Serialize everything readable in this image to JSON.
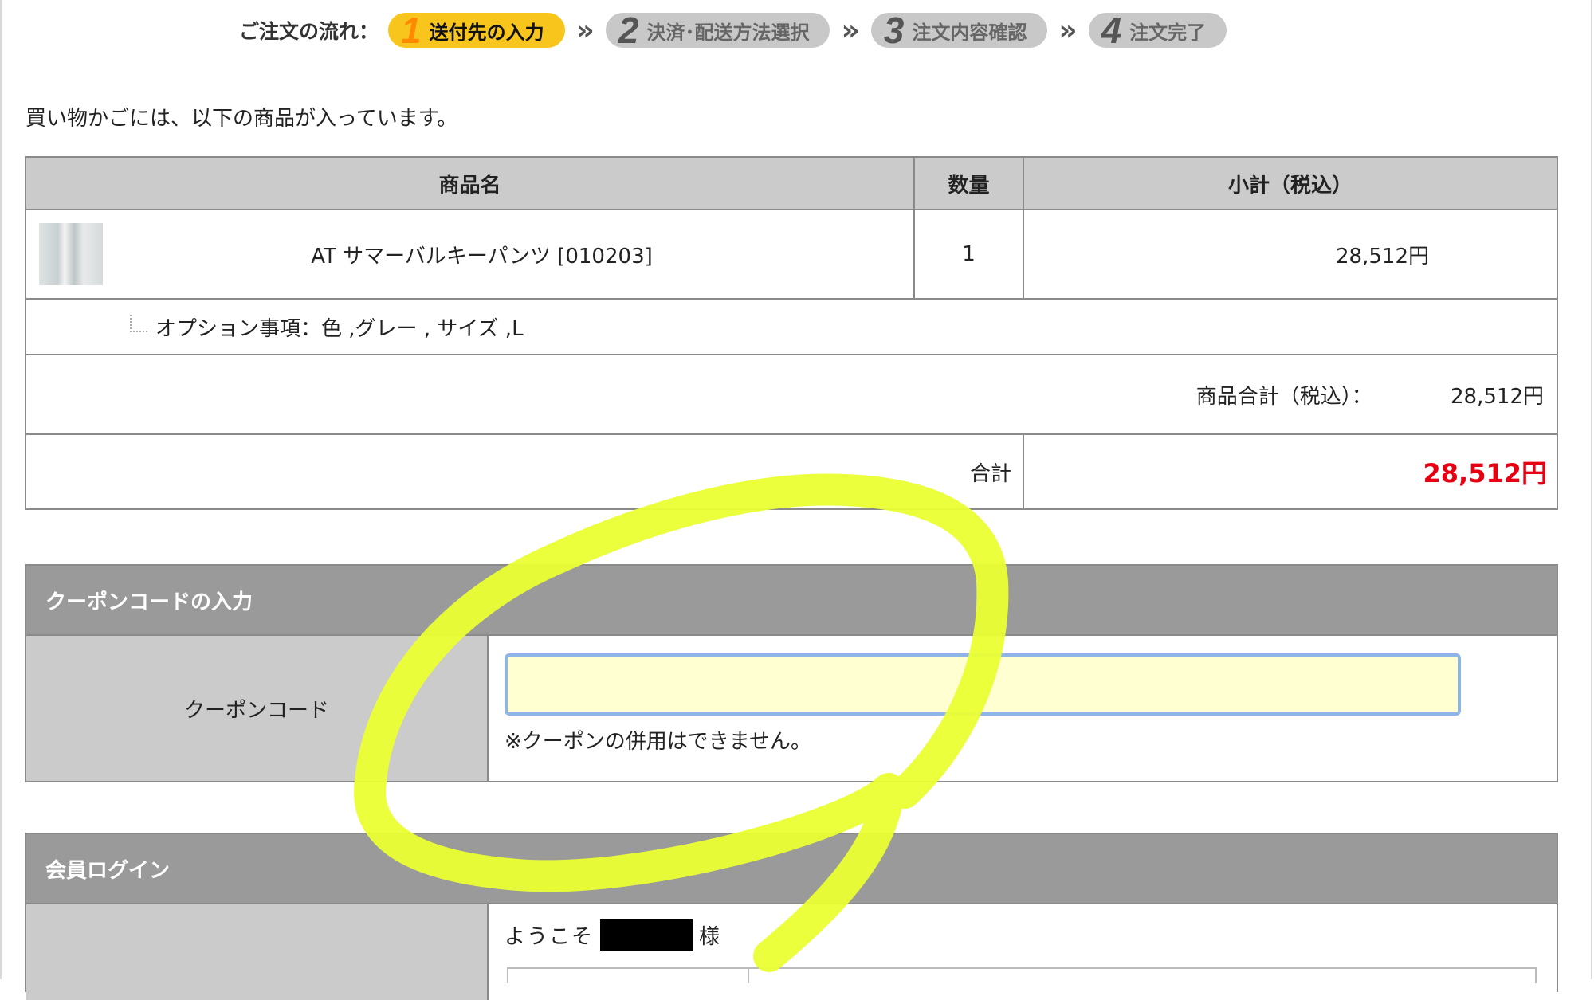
{
  "order_flow": {
    "label": "ご注文の流れ：",
    "steps": [
      {
        "num": "1",
        "label": "送付先の入力"
      },
      {
        "num": "2",
        "label": "決済･配送方法選択"
      },
      {
        "num": "3",
        "label": "注文内容確認"
      },
      {
        "num": "4",
        "label": "注文完了"
      }
    ],
    "arrow": "»",
    "active_color": "#f7c51c"
  },
  "intro_text": "買い物かごには、以下の商品が入っています。",
  "cart": {
    "headers": {
      "name": "商品名",
      "qty": "数量",
      "subtotal": "小計（税込）"
    },
    "item": {
      "name": "AT サマーバルキーパンツ [010203]",
      "qty": "1",
      "price": "28,512円",
      "options": "オプション事項：色 ,グレー , サイズ ,L"
    },
    "subtotal_label": "商品合計（税込）：",
    "subtotal_value": "28,512円",
    "total_label": "合計",
    "total_value": "28,512円",
    "total_color": "#e60012"
  },
  "coupon": {
    "title": "クーポンコードの入力",
    "label": "クーポンコード",
    "value": "",
    "note": "※クーポンの併用はできません。"
  },
  "member": {
    "title": "会員ログイン",
    "welcome_prefix": "ようこそ",
    "welcome_suffix": "様"
  },
  "annotation_color": "#eaff33"
}
